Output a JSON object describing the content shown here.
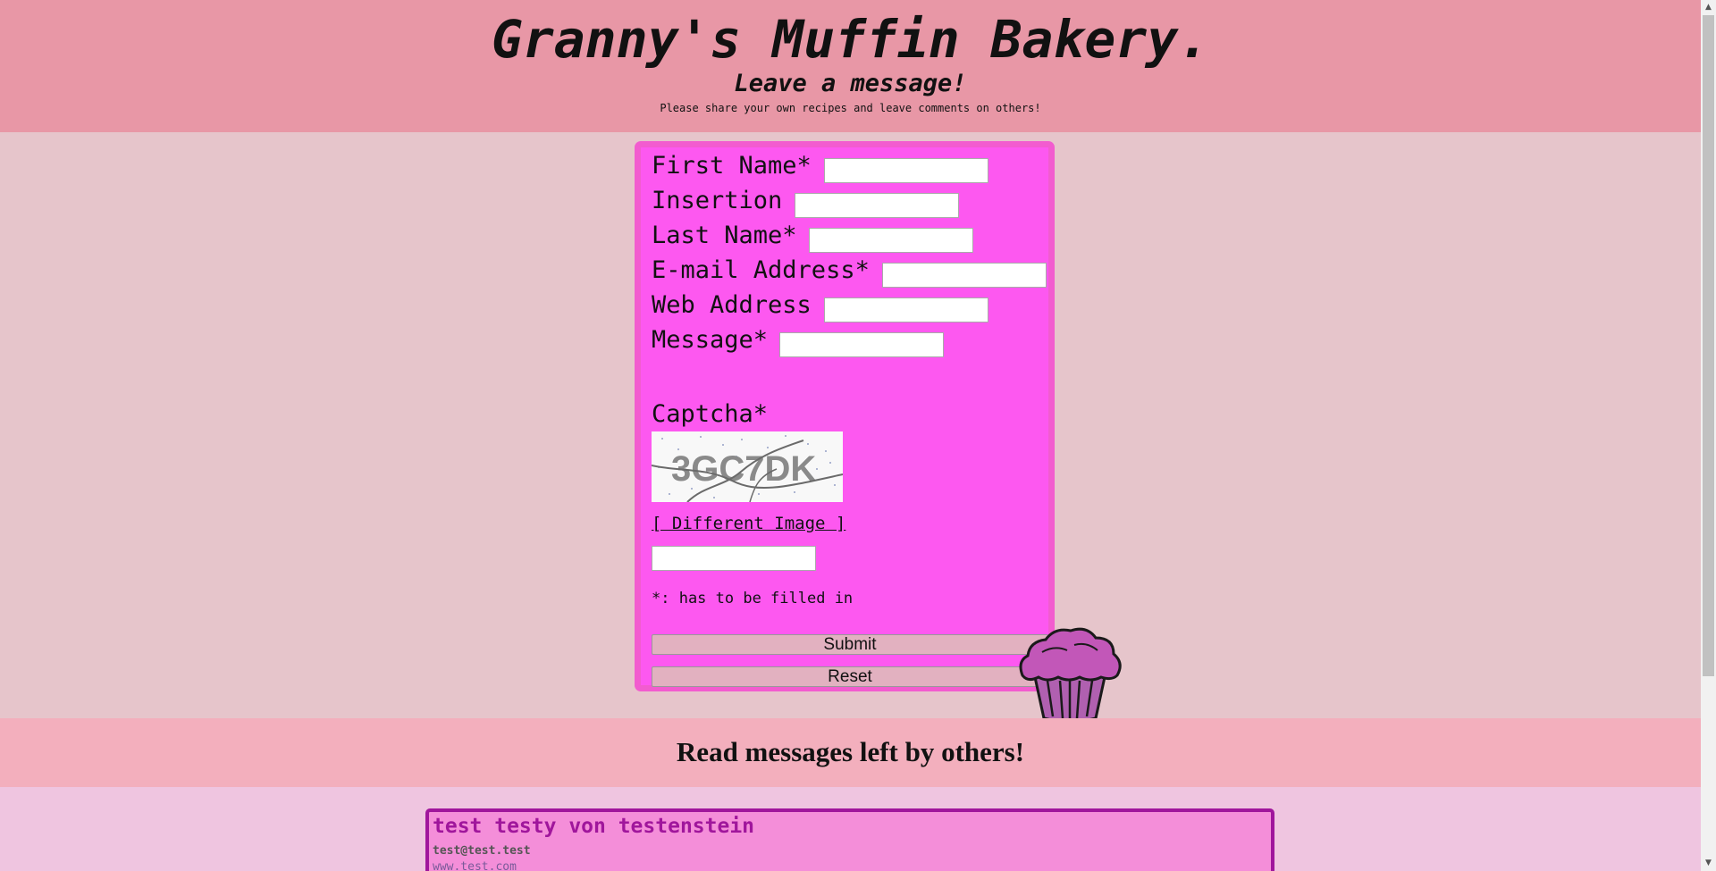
{
  "header": {
    "title": "Granny's Muffin Bakery.",
    "subtitle": "Leave a message!",
    "tagline": "Please share your own recipes and leave comments on others!"
  },
  "form": {
    "first_name_label": "First Name*",
    "insertion_label": "Insertion",
    "last_name_label": "Last Name*",
    "email_label": "E-mail Address*",
    "web_label": "Web Address",
    "message_label": "Message*",
    "captcha_label": "Captcha*",
    "captcha_text": "3GC7DK",
    "different_image_link": "[ Different Image ]",
    "required_note": "*: has to be filled in",
    "submit_label": "Submit",
    "reset_label": "Reset",
    "first_name_value": "",
    "insertion_value": "",
    "last_name_value": "",
    "email_value": "",
    "web_value": "",
    "message_value": "",
    "captcha_value": ""
  },
  "messages": {
    "title": "Read messages left by others!",
    "items": [
      {
        "name": "test testy von testenstein",
        "email": "test@test.test",
        "web": "www.test.com"
      }
    ]
  },
  "colors": {
    "header_bg": "#e897a6",
    "form_bg": "#fd58f0",
    "message_card_bg": "#f48ed9",
    "accent": "#a0169c"
  }
}
